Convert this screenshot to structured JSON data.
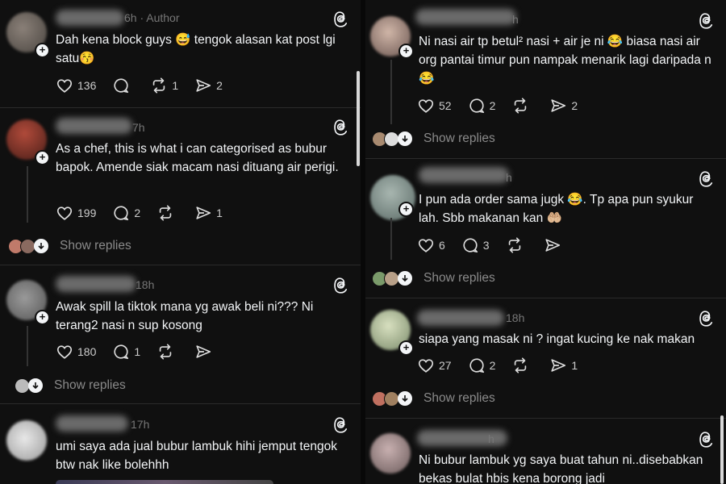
{
  "app": {
    "theme_bg": "#101010",
    "accent": "#f3f5f7"
  },
  "left": {
    "posts": [
      {
        "time": "6h · Author",
        "text": "Dah kena block guys 😅  tengok alasan kat post lgi satu😚",
        "likes": "136",
        "reposts": "1",
        "shares": "2",
        "replies": ""
      },
      {
        "time": "7h",
        "text": "As a chef, this is what i can categorised as bubur bapok. Amende siak macam nasi dituang air perigi.",
        "likes": "199",
        "reposts": "",
        "shares": "1",
        "replies": "2",
        "show_replies": "Show replies"
      },
      {
        "time": "18h",
        "text": "Awak spill la tiktok mana yg awak beli ni??? Ni terang2 nasi n sup kosong",
        "likes": "180",
        "reposts": "",
        "shares": "",
        "replies": "1",
        "show_replies": "Show replies"
      },
      {
        "time": "17h",
        "text": "umi saya ada jual bubur lambuk hihi jemput tengok btw nak like bolehhh"
      }
    ]
  },
  "right": {
    "posts": [
      {
        "time": "h",
        "text": "Ni nasi air tp betul² nasi + air je ni 😂 biasa nasi air org pantai timur pun nampak menarik lagi daripada n 😂",
        "likes": "52",
        "replies": "2",
        "reposts": "",
        "shares": "2",
        "show_replies": "Show replies"
      },
      {
        "time": "h",
        "text": "I pun ada order sama jugk 😂. Tp apa pun syukur lah. Sbb makanan kan 🤲🏼",
        "likes": "6",
        "replies": "3",
        "reposts": "",
        "shares": "",
        "show_replies": "Show replies"
      },
      {
        "time": "18h",
        "text": "siapa yang masak ni ? ingat kucing ke nak makan",
        "likes": "27",
        "replies": "2",
        "reposts": "",
        "shares": "1",
        "show_replies": "Show replies"
      },
      {
        "time": "h",
        "text": "Ni bubur lambuk yg saya buat tahun ni..disebabkan bekas bulat hbis kena borong jadi"
      }
    ]
  },
  "icons": {
    "like": "heart-icon",
    "reply": "comment-icon",
    "repost": "repost-icon",
    "share": "share-icon",
    "threads": "threads-logo-icon",
    "expand": "chevron-down-icon",
    "follow": "plus-icon"
  }
}
